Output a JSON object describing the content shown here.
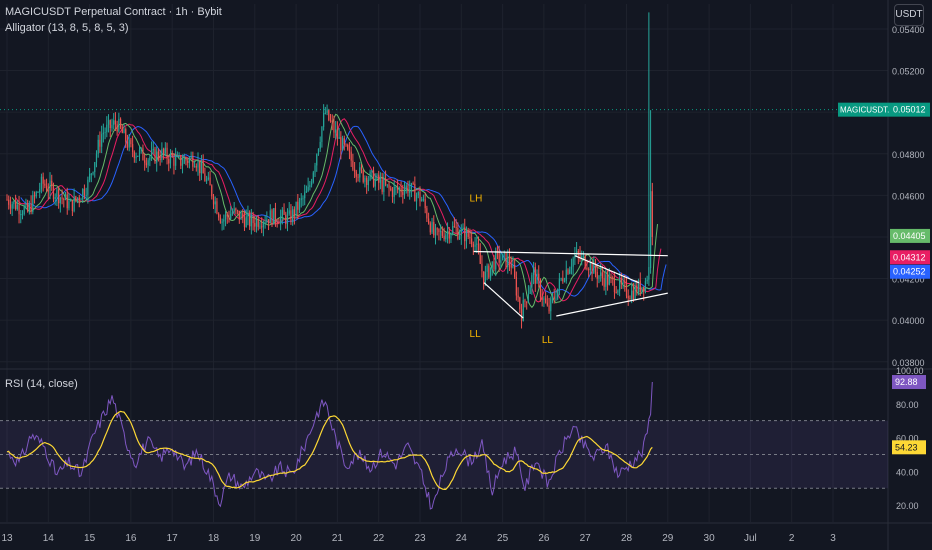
{
  "header": {
    "title": "MAGICUSDT Perpetual Contract · 1h · Bybit",
    "indicator": "Alligator (13, 8, 5, 8, 5, 3)",
    "currency": "USDT"
  },
  "rsi_panel": {
    "label": "RSI (14, close)"
  },
  "colors": {
    "background": "#131722",
    "up_candle": "#26a69a",
    "down_candle": "#ef5350",
    "jaw": "#2962ff",
    "teeth": "#e91e63",
    "lips": "#66bb6a",
    "rsi_line": "#7e57c2",
    "rsi_ma": "#fdd835",
    "rsi_band": "#7e57c2",
    "trendline": "#ffffff",
    "annotation": "#f7b500"
  },
  "chart_data": [
    {
      "type": "candlestick",
      "panel": "price",
      "x_ticks": [
        "13",
        "14",
        "15",
        "16",
        "17",
        "18",
        "19",
        "20",
        "21",
        "22",
        "23",
        "24",
        "25",
        "26",
        "27",
        "28",
        "29",
        "30",
        "Jul",
        "2",
        "3"
      ],
      "y_ticks": [
        "0.03800",
        "0.04000",
        "0.04200",
        "0.04400",
        "0.04600",
        "0.04800",
        "0.05000",
        "0.05200",
        "0.05400"
      ],
      "ylim": [
        0.0377,
        0.0552
      ],
      "xlim": [
        13.0,
        16.9
      ],
      "key_points": [
        {
          "day": 13.0,
          "price": 0.0458
        },
        {
          "day": 13.5,
          "price": 0.0452
        },
        {
          "day": 13.85,
          "price": 0.0466
        },
        {
          "day": 14.2,
          "price": 0.0461
        },
        {
          "day": 14.55,
          "price": 0.0455
        },
        {
          "day": 14.95,
          "price": 0.0465
        },
        {
          "day": 15.3,
          "price": 0.049
        },
        {
          "day": 15.65,
          "price": 0.0495
        },
        {
          "day": 16.0,
          "price": 0.0482
        },
        {
          "day": 16.4,
          "price": 0.0478
        },
        {
          "day": 16.75,
          "price": 0.048
        },
        {
          "day": 17.15,
          "price": 0.0476
        },
        {
          "day": 17.55,
          "price": 0.0478
        },
        {
          "day": 17.95,
          "price": 0.0462
        },
        {
          "day": 18.2,
          "price": 0.0448
        },
        {
          "day": 18.45,
          "price": 0.0452
        },
        {
          "day": 18.9,
          "price": 0.0447
        },
        {
          "day": 19.4,
          "price": 0.045
        },
        {
          "day": 19.85,
          "price": 0.0449
        },
        {
          "day": 20.3,
          "price": 0.0462
        },
        {
          "day": 20.7,
          "price": 0.05
        },
        {
          "day": 21.05,
          "price": 0.0486
        },
        {
          "day": 21.3,
          "price": 0.0478
        },
        {
          "day": 21.55,
          "price": 0.047
        },
        {
          "day": 21.85,
          "price": 0.0468
        },
        {
          "day": 22.3,
          "price": 0.0462
        },
        {
          "day": 22.7,
          "price": 0.0464
        },
        {
          "day": 23.05,
          "price": 0.0458
        },
        {
          "day": 23.35,
          "price": 0.044
        },
        {
          "day": 23.8,
          "price": 0.0444
        },
        {
          "day": 24.3,
          "price": 0.0439
        },
        {
          "day": 24.55,
          "price": 0.042
        },
        {
          "day": 24.85,
          "price": 0.043
        },
        {
          "day": 25.2,
          "price": 0.0428
        },
        {
          "day": 25.45,
          "price": 0.0403
        },
        {
          "day": 25.75,
          "price": 0.0423
        },
        {
          "day": 26.1,
          "price": 0.0404
        },
        {
          "day": 26.45,
          "price": 0.0421
        },
        {
          "day": 26.75,
          "price": 0.0431
        },
        {
          "day": 27.05,
          "price": 0.0428
        },
        {
          "day": 27.35,
          "price": 0.0421
        },
        {
          "day": 27.75,
          "price": 0.0417
        },
        {
          "day": 28.1,
          "price": 0.0413
        },
        {
          "day": 28.45,
          "price": 0.0418
        },
        {
          "day": 28.55,
          "price": 0.0425
        },
        {
          "day": 28.65,
          "price": 0.044
        }
      ],
      "spike_high": 0.0548,
      "current_price": 0.044,
      "alligator": {
        "lips_last": 0.04405,
        "teeth_last": 0.04312,
        "jaw_last": 0.04252
      },
      "price_labels": [
        {
          "text": "MAGICUSDT.P",
          "value": "0.05012",
          "price": 0.05012,
          "color": "#089981"
        },
        {
          "text": "",
          "value": "0.04405",
          "price": 0.04405,
          "color": "#66bb6a"
        },
        {
          "text": "",
          "value": "0.04312",
          "price": 0.04312,
          "color": "#e91e63"
        },
        {
          "text": "",
          "value": "0.04252",
          "price": 0.04252,
          "color": "#2962ff"
        }
      ],
      "annotations": [
        {
          "text": "LH",
          "day": 24.2,
          "price": 0.0457
        },
        {
          "text": "LL",
          "day": 24.2,
          "price": 0.0392
        },
        {
          "text": "LL",
          "day": 25.95,
          "price": 0.0389
        }
      ],
      "trendlines": [
        {
          "from": [
            24.3,
            0.0433
          ],
          "to": [
            29.0,
            0.0431
          ]
        },
        {
          "from": [
            24.55,
            0.0418
          ],
          "to": [
            25.5,
            0.0401
          ]
        },
        {
          "from": [
            26.3,
            0.0402
          ],
          "to": [
            29.0,
            0.0413
          ]
        },
        {
          "from": [
            26.75,
            0.0431
          ],
          "to": [
            28.3,
            0.0418
          ]
        }
      ]
    },
    {
      "type": "line",
      "panel": "rsi",
      "series": [
        {
          "name": "RSI (14, close)",
          "last": 92.88
        },
        {
          "name": "RSI MA",
          "last": 54.23
        }
      ],
      "y_ticks": [
        "20.00",
        "40.00",
        "60.00",
        "80.00",
        "100.00"
      ],
      "ylim": [
        10,
        100
      ],
      "band": [
        30,
        70
      ],
      "midline": 50,
      "last_labels": [
        {
          "value": "92.88",
          "num": 92.88,
          "color": "#7e57c2"
        },
        {
          "value": "54.23",
          "num": 54.23,
          "color": "#fdd835"
        }
      ],
      "rsi_key_points": [
        {
          "day": 13.0,
          "v": 52
        },
        {
          "day": 13.3,
          "v": 45
        },
        {
          "day": 13.6,
          "v": 62
        },
        {
          "day": 13.9,
          "v": 55
        },
        {
          "day": 14.2,
          "v": 38
        },
        {
          "day": 14.5,
          "v": 45
        },
        {
          "day": 14.8,
          "v": 38
        },
        {
          "day": 15.1,
          "v": 62
        },
        {
          "day": 15.35,
          "v": 74
        },
        {
          "day": 15.55,
          "v": 84
        },
        {
          "day": 15.85,
          "v": 60
        },
        {
          "day": 16.1,
          "v": 45
        },
        {
          "day": 16.4,
          "v": 58
        },
        {
          "day": 16.7,
          "v": 48
        },
        {
          "day": 17.0,
          "v": 55
        },
        {
          "day": 17.3,
          "v": 42
        },
        {
          "day": 17.6,
          "v": 52
        },
        {
          "day": 17.9,
          "v": 38
        },
        {
          "day": 18.15,
          "v": 22
        },
        {
          "day": 18.4,
          "v": 38
        },
        {
          "day": 18.7,
          "v": 30
        },
        {
          "day": 19.0,
          "v": 40
        },
        {
          "day": 19.3,
          "v": 34
        },
        {
          "day": 19.6,
          "v": 42
        },
        {
          "day": 19.9,
          "v": 38
        },
        {
          "day": 20.2,
          "v": 55
        },
        {
          "day": 20.5,
          "v": 74
        },
        {
          "day": 20.7,
          "v": 82
        },
        {
          "day": 20.95,
          "v": 60
        },
        {
          "day": 21.2,
          "v": 44
        },
        {
          "day": 21.5,
          "v": 50
        },
        {
          "day": 21.8,
          "v": 42
        },
        {
          "day": 22.1,
          "v": 52
        },
        {
          "day": 22.4,
          "v": 44
        },
        {
          "day": 22.7,
          "v": 55
        },
        {
          "day": 23.0,
          "v": 40
        },
        {
          "day": 23.3,
          "v": 18
        },
        {
          "day": 23.6,
          "v": 42
        },
        {
          "day": 23.9,
          "v": 55
        },
        {
          "day": 24.2,
          "v": 46
        },
        {
          "day": 24.5,
          "v": 55
        },
        {
          "day": 24.75,
          "v": 28
        },
        {
          "day": 25.0,
          "v": 46
        },
        {
          "day": 25.3,
          "v": 52
        },
        {
          "day": 25.55,
          "v": 30
        },
        {
          "day": 25.8,
          "v": 48
        },
        {
          "day": 26.1,
          "v": 32
        },
        {
          "day": 26.4,
          "v": 52
        },
        {
          "day": 26.7,
          "v": 66
        },
        {
          "day": 26.95,
          "v": 56
        },
        {
          "day": 27.2,
          "v": 48
        },
        {
          "day": 27.5,
          "v": 55
        },
        {
          "day": 27.8,
          "v": 38
        },
        {
          "day": 28.1,
          "v": 45
        },
        {
          "day": 28.4,
          "v": 52
        },
        {
          "day": 28.55,
          "v": 70
        },
        {
          "day": 28.65,
          "v": 92.88
        }
      ]
    }
  ]
}
